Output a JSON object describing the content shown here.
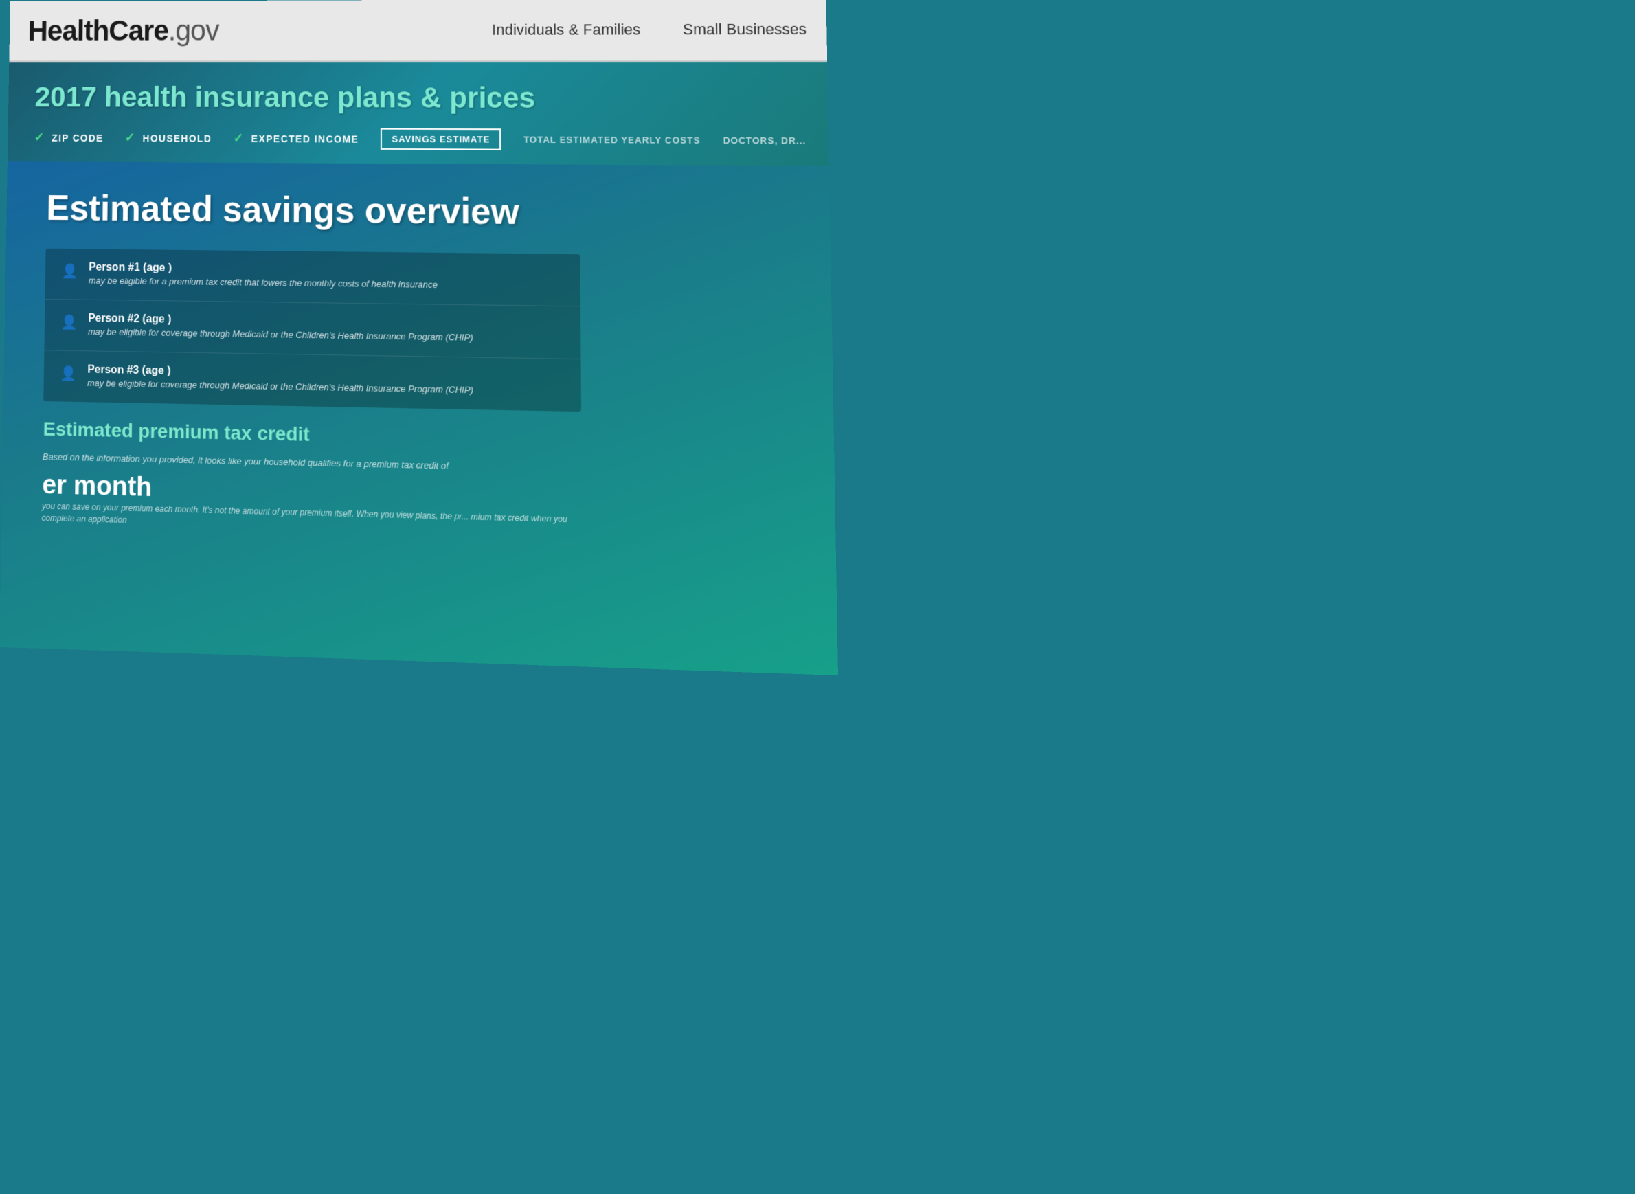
{
  "header": {
    "logo_main": "HealthCare",
    "logo_suffix": ".gov",
    "nav_items": [
      {
        "label": "Individuals & Families"
      },
      {
        "label": "Small Businesses"
      }
    ]
  },
  "banner": {
    "title": "2017 health insurance plans & prices"
  },
  "steps": {
    "completed": [
      {
        "label": "ZIP CODE"
      },
      {
        "label": "HOUSEHOLD"
      },
      {
        "label": "EXPECTED INCOME"
      }
    ],
    "active": {
      "label": "SAVINGS ESTIMATE"
    },
    "upcoming": [
      {
        "label": "TOTAL ESTIMATED YEARLY COSTS"
      },
      {
        "label": "DOCTORS, DR..."
      }
    ]
  },
  "main": {
    "section_title": "Estimated savings overview",
    "side_text_1": "may be eligible for a premium tax credit that lowers the monthly costs of health insurance",
    "side_text_2": "may be eligible for coverage through Medicaid or the Children's Health Insurance Program (CHIP)",
    "side_text_3": "may be eligible for coverage through Medicaid or the Children's Health Insurance Program (CHIP)",
    "persons": [
      {
        "name": "Person #1 (age )",
        "description": "may be eligible for a premium tax credit that lowers the monthly costs of health insurance"
      },
      {
        "name": "Person #2 (age )",
        "description": "may be eligible for coverage through Medicaid or the Children's Health Insurance Program (CHIP)"
      },
      {
        "name": "Person #3 (age )",
        "description": "may be eligible for coverage through Medicaid or the Children's Health Insurance Program (CHIP)"
      }
    ],
    "tax_credit": {
      "title": "Estimated premium tax credit",
      "description": "Based on the information you provided, it looks like your household qualifies for a premium tax credit of",
      "per_month_label": "er month",
      "per_month_desc": "you can save on your premium each month. It's not the amount of your premium itself. When you view plans, the pr... mium tax credit when you complete an application"
    }
  }
}
